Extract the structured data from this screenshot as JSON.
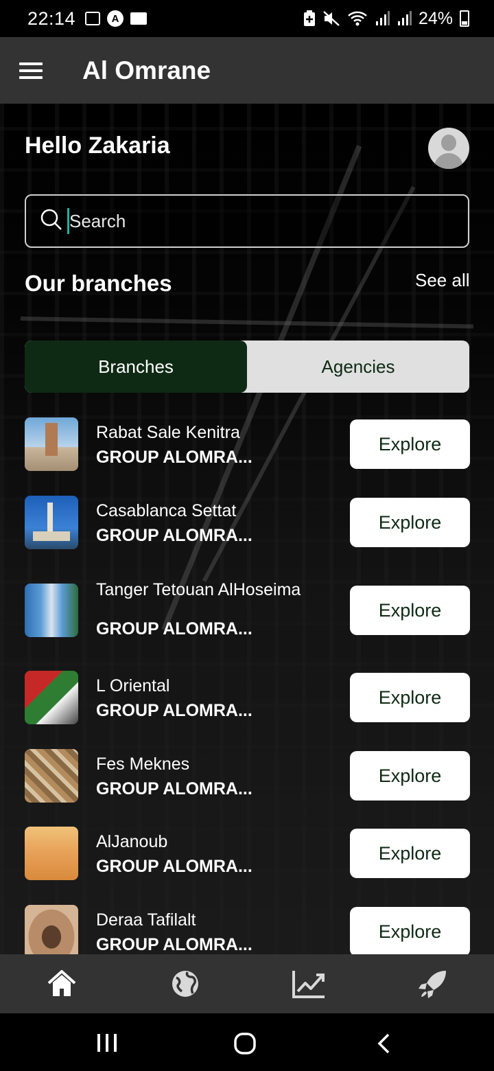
{
  "status_bar": {
    "time": "22:14",
    "battery": "24%",
    "icons": [
      "image-icon",
      "a-circle-icon",
      "folder-icon",
      "battery-saver-icon",
      "mute-icon",
      "wifi-icon",
      "signal-icon",
      "signal-icon",
      "battery-icon"
    ]
  },
  "app_bar": {
    "title": "Al Omrane",
    "menu_icon": "hamburger-menu-icon"
  },
  "main": {
    "greeting": "Hello Zakaria",
    "avatar_icon": "user-avatar-icon",
    "search": {
      "placeholder": "Search",
      "value": ""
    },
    "section_title": "Our branches",
    "see_all": "See all",
    "tabs": [
      {
        "label": "Branches",
        "active": true
      },
      {
        "label": "Agencies",
        "active": false
      }
    ],
    "branches": [
      {
        "name": "Rabat Sale Kenitra",
        "subtitle": "GROUP ALOMRA...",
        "button": "Explore"
      },
      {
        "name": "Casablanca Settat",
        "subtitle": "GROUP ALOMRA...",
        "button": "Explore"
      },
      {
        "name": "Tanger Tetouan AlHoseima",
        "subtitle": "GROUP ALOMRA...",
        "button": "Explore"
      },
      {
        "name": "L Oriental",
        "subtitle": "GROUP ALOMRA...",
        "button": "Explore"
      },
      {
        "name": "Fes Meknes",
        "subtitle": "GROUP ALOMRA...",
        "button": "Explore"
      },
      {
        "name": "AlJanoub",
        "subtitle": "GROUP ALOMRA...",
        "button": "Explore"
      },
      {
        "name": "Deraa Tafilalt",
        "subtitle": "GROUP ALOMRA...",
        "button": "Explore"
      }
    ]
  },
  "bottom_nav": {
    "items": [
      "home-icon",
      "globe-icon",
      "chart-line-icon",
      "rocket-icon"
    ]
  },
  "system_nav": {
    "items": [
      "recent-apps-icon",
      "home-circle-icon",
      "back-icon"
    ]
  },
  "colors": {
    "accent_dark_green": "#0e2a14",
    "bar_gray": "#333333",
    "cursor_teal": "#1bb3a0"
  }
}
